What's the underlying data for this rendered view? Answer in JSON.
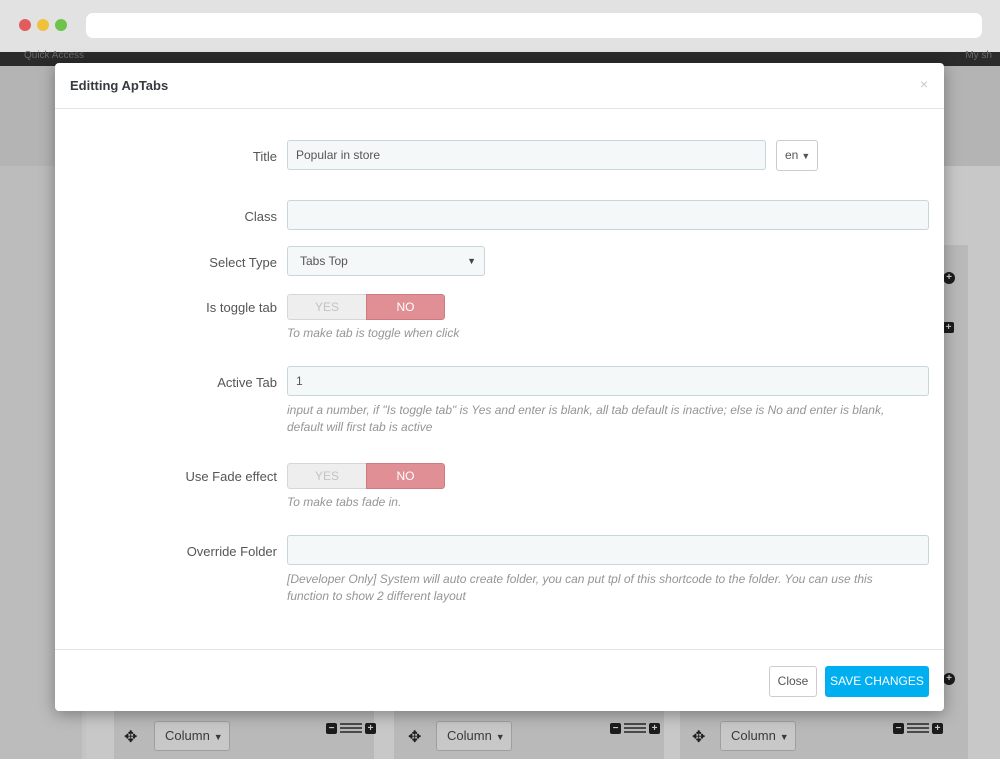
{
  "background": {
    "topbar_left": "Quick Access",
    "topbar_right": "My sh",
    "column_label": "Column"
  },
  "modal": {
    "title": "Editting ApTabs",
    "close_glyph": "×",
    "fields": {
      "title_label": "Title",
      "title_value": "Popular in store",
      "lang_value": "en",
      "class_label": "Class",
      "class_value": "",
      "select_type_label": "Select Type",
      "select_type_value": "Tabs Top",
      "toggle_label": "Is toggle tab",
      "toggle_yes": "YES",
      "toggle_no": "NO",
      "toggle_help": "To make tab is toggle when click",
      "active_tab_label": "Active Tab",
      "active_tab_value": "1",
      "active_tab_help": "input a number, if \"Is toggle tab\" is Yes and enter is blank, all tab default is inactive; else is No and enter is blank, default will first tab is active",
      "fade_label": "Use Fade effect",
      "fade_yes": "YES",
      "fade_no": "NO",
      "fade_help": "To make tabs fade in.",
      "override_label": "Override Folder",
      "override_value": "",
      "override_help": "[Developer Only] System will auto create folder, you can put tpl of this shortcode to the folder. You can use this function to show 2 different layout"
    },
    "footer": {
      "close_label": "Close",
      "save_label": "SAVE CHANGES"
    }
  },
  "colors": {
    "primary": "#00aff0",
    "switch_off": "#e08f95"
  }
}
